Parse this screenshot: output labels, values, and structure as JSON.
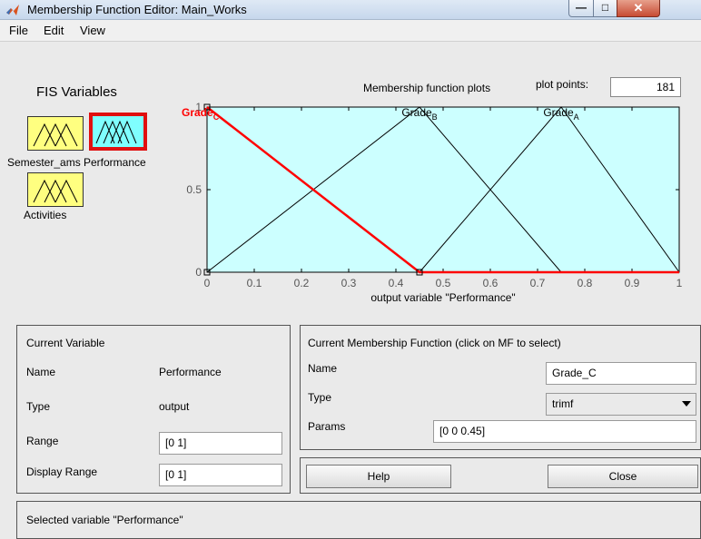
{
  "window": {
    "title": "Membership Function Editor: Main_Works"
  },
  "menu": [
    "File",
    "Edit",
    "View"
  ],
  "fis_variables": {
    "title": "FIS Variables",
    "items": [
      {
        "label": "Semester_ams",
        "selected": false
      },
      {
        "label": "Performance",
        "selected": true
      },
      {
        "label": "Activities",
        "selected": false
      }
    ]
  },
  "plot": {
    "header": "Membership function plots",
    "plot_points_label": "plot points:",
    "plot_points_value": "181"
  },
  "chart_data": {
    "type": "line",
    "xlabel": "output variable \"Performance\"",
    "xlim": [
      0,
      1
    ],
    "ylim": [
      0,
      1
    ],
    "x_ticks": [
      "0",
      "0.1",
      "0.2",
      "0.3",
      "0.4",
      "0.5",
      "0.6",
      "0.7",
      "0.8",
      "0.9",
      "1"
    ],
    "y_ticks": [
      "0",
      "0.5",
      "1"
    ],
    "series": [
      {
        "name": "Grade",
        "subscript": "C",
        "points": [
          [
            0,
            1
          ],
          [
            0,
            1
          ],
          [
            0.45,
            0
          ],
          [
            1,
            0
          ]
        ],
        "color": "#ff0000",
        "selected": true
      },
      {
        "name": "Grade",
        "subscript": "B",
        "points": [
          [
            0,
            0
          ],
          [
            0.45,
            1
          ],
          [
            0.75,
            0
          ],
          [
            1,
            0
          ]
        ],
        "color": "#000000",
        "selected": false
      },
      {
        "name": "Grade",
        "subscript": "A",
        "points": [
          [
            0,
            0
          ],
          [
            0.45,
            0
          ],
          [
            0.75,
            1
          ],
          [
            1,
            0
          ]
        ],
        "color": "#000000",
        "selected": false
      }
    ],
    "background": "#ccffff"
  },
  "current_variable": {
    "title": "Current Variable",
    "name_label": "Name",
    "name_value": "Performance",
    "type_label": "Type",
    "type_value": "output",
    "range_label": "Range",
    "range_value": "[0 1]",
    "display_range_label": "Display Range",
    "display_range_value": "[0 1]"
  },
  "current_mf": {
    "title": "Current Membership Function (click on MF to select)",
    "name_label": "Name",
    "name_value": "Grade_C",
    "type_label": "Type",
    "type_value": "trimf",
    "params_label": "Params",
    "params_value": "[0 0 0.45]"
  },
  "buttons": {
    "help": "Help",
    "close": "Close"
  },
  "status": "Selected variable \"Performance\""
}
